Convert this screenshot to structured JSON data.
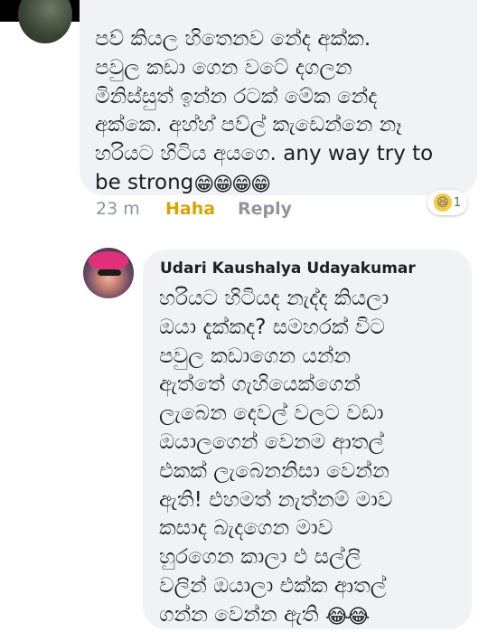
{
  "comment1": {
    "lines": [
      "පව් කියල හිතෙනව නේද අක්ක.",
      "පවුල කඩා ගෙන වටේ දගලන",
      "මිනිස්සුත් ඉන්න රටක් මේක නේද",
      "අක්කෙ. අහ්හ් පව්ල් කැඩෙන්නෙ නෑ",
      "හරියට හිටිය අයගෙ. any way try to",
      "be strong"
    ],
    "emoji": "😁😁😁😁",
    "time": "23 m",
    "action_haha": "Haha",
    "action_reply": "Reply",
    "reaction_icon": "haha-emoji",
    "reaction_count": "1"
  },
  "comment2": {
    "author": "Udari Kaushalya Udayakumar",
    "lines": [
      "හරියට හිටියද නැද්ද කියලා",
      "ඔයා දැක්කද? සමහරක් විට",
      "පවුල කඩාගෙන යන්න",
      "ඇත්තේ ගැහියෙක්ගෙන්",
      "ලැබෙන දෙවල් වලට වඩා",
      "ඔයාලගෙන් වෙනම ආතල්",
      "එකක් ලැබෙනනිසා වෙන්න",
      "ඇති! එහමත් නැත්නම් මාව",
      "කසාද බැදගෙන මාව",
      "හුරගෙන කාලා එ සල්ලි",
      "වලින් ඔයාලා එක්ක ආතල්",
      "ගන්න වෙන්න ඇති"
    ],
    "emoji": "😂😂"
  }
}
